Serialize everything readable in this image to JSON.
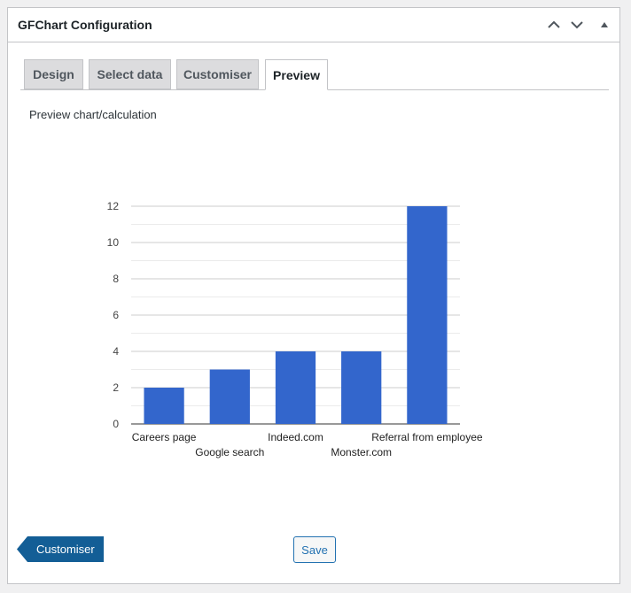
{
  "panel": {
    "title": "GFChart Configuration",
    "controls": [
      "chevron-up-icon",
      "chevron-down-icon",
      "triangle-up-icon"
    ]
  },
  "tabs": [
    {
      "label": "Design",
      "active": false
    },
    {
      "label": "Select data",
      "active": false
    },
    {
      "label": "Customiser",
      "active": false
    },
    {
      "label": "Preview",
      "active": true
    }
  ],
  "preview": {
    "label": "Preview chart/calculation"
  },
  "chart_data": {
    "type": "bar",
    "categories": [
      "Careers page",
      "Google search",
      "Indeed.com",
      "Monster.com",
      "Referral from employee"
    ],
    "values": [
      2,
      3,
      4,
      4,
      12
    ],
    "ylim": [
      0,
      12
    ],
    "yticks": [
      0,
      2,
      4,
      6,
      8,
      10,
      12
    ],
    "bar_color": "#3366cc",
    "grid": true,
    "legend": "none"
  },
  "footer": {
    "back_label": "Customiser",
    "save_label": "Save"
  },
  "colors": {
    "accent": "#2271b1",
    "back_button": "#135e96"
  }
}
